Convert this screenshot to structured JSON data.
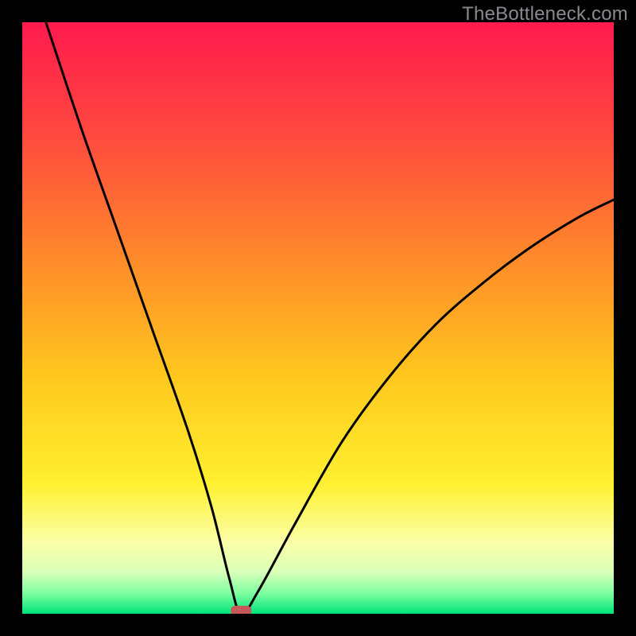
{
  "watermark": "TheBottleneck.com",
  "chart_data": {
    "type": "line",
    "title": "",
    "xlabel": "",
    "ylabel": "",
    "xlim": [
      0,
      100
    ],
    "ylim": [
      0,
      100
    ],
    "curve": {
      "min_x": 37,
      "series": [
        {
          "x": 4,
          "y": 100
        },
        {
          "x": 10,
          "y": 82
        },
        {
          "x": 16,
          "y": 65
        },
        {
          "x": 22,
          "y": 48
        },
        {
          "x": 28,
          "y": 31
        },
        {
          "x": 32,
          "y": 18
        },
        {
          "x": 35,
          "y": 6
        },
        {
          "x": 37,
          "y": 0
        },
        {
          "x": 40,
          "y": 4
        },
        {
          "x": 46,
          "y": 15
        },
        {
          "x": 54,
          "y": 29
        },
        {
          "x": 62,
          "y": 40
        },
        {
          "x": 70,
          "y": 49
        },
        {
          "x": 78,
          "y": 56
        },
        {
          "x": 86,
          "y": 62
        },
        {
          "x": 94,
          "y": 67
        },
        {
          "x": 100,
          "y": 70
        }
      ]
    },
    "marker": {
      "x": 37,
      "y": 0,
      "color": "#c65a5a"
    },
    "gradient_stops": [
      {
        "offset": 0.0,
        "color": "#ff1a4d"
      },
      {
        "offset": 0.18,
        "color": "#ff4640"
      },
      {
        "offset": 0.4,
        "color": "#ff8a2a"
      },
      {
        "offset": 0.6,
        "color": "#ffc81e"
      },
      {
        "offset": 0.78,
        "color": "#fff030"
      },
      {
        "offset": 0.88,
        "color": "#fbffa8"
      },
      {
        "offset": 0.93,
        "color": "#d8ffb8"
      },
      {
        "offset": 0.965,
        "color": "#7effa0"
      },
      {
        "offset": 1.0,
        "color": "#00e37a"
      }
    ]
  }
}
